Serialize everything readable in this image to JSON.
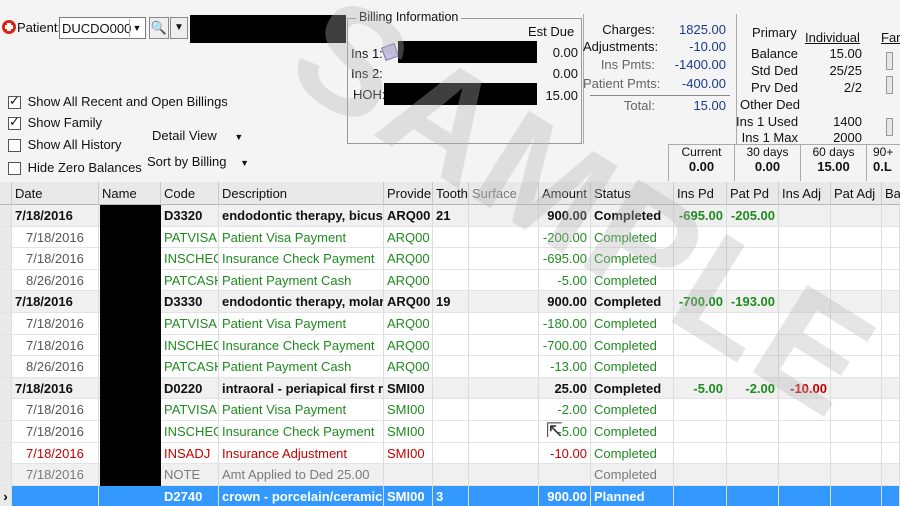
{
  "patient": {
    "label": "Patient:",
    "code": "DUCDO000"
  },
  "checkboxes": [
    {
      "label": "Show All Recent and Open Billings",
      "checked": true
    },
    {
      "label": "Show Family",
      "checked": true
    },
    {
      "label": "Show All History",
      "checked": false
    },
    {
      "label": "Hide Zero Balances",
      "checked": false
    }
  ],
  "dropdowns": {
    "detail": "Detail View",
    "sort": "Sort by Billing"
  },
  "billing": {
    "title": "Billing Information",
    "est_due_label": "Est Due",
    "rows": [
      {
        "label": "Ins 1:",
        "value": "0.00"
      },
      {
        "label": "Ins 2:",
        "value": "0.00"
      },
      {
        "label": "HOH:",
        "value": "15.00"
      }
    ]
  },
  "totals": {
    "rows": [
      {
        "label": "Charges:",
        "value": "1825.00"
      },
      {
        "label": "Adjustments:",
        "value": "-10.00"
      },
      {
        "label": "Ins Pmts:",
        "value": "-1400.00"
      },
      {
        "label": "Patient Pmts:",
        "value": "-400.00"
      },
      {
        "label": "Total:",
        "value": "15.00"
      }
    ]
  },
  "insurance": {
    "primary": "Primary",
    "individual": "Individual",
    "family_partial": "Far",
    "rows": [
      {
        "label": "Balance",
        "value": "15.00"
      },
      {
        "label": "Std Ded",
        "value": "25/25"
      },
      {
        "label": "Prv Ded",
        "value": "2/2"
      },
      {
        "label": "Other Ded",
        "value": ""
      },
      {
        "label": "Ins 1 Used",
        "value": "1400"
      },
      {
        "label": "Ins 1 Max",
        "value": "2000"
      }
    ]
  },
  "aging": [
    {
      "label": "Current",
      "value": "0.00"
    },
    {
      "label": "30 days",
      "value": "0.00"
    },
    {
      "label": "60 days",
      "value": "15.00"
    },
    {
      "label": "90+",
      "value": "0.L"
    }
  ],
  "columns": [
    "Date",
    "Name",
    "Code",
    "Description",
    "Provider",
    "Tooth",
    "Surface",
    "Amount",
    "Status",
    "Ins Pd",
    "Pat Pd",
    "Ins Adj",
    "Pat Adj",
    "Ba"
  ],
  "rows": [
    {
      "kind": "proc",
      "date": "7/18/2016",
      "code": "D3320",
      "desc": "endodontic therapy, bicus",
      "provider": "ARQ00",
      "tooth": "21",
      "amount": "900.00",
      "status": "Completed",
      "ins_pd": "-695.00",
      "pat_pd": "-205.00",
      "ins_adj": ""
    },
    {
      "kind": "pay",
      "date": "7/18/2016",
      "code": "PATVISA",
      "desc": "Patient Visa Payment",
      "provider": "ARQ00",
      "tooth": "",
      "amount": "-200.00",
      "status": "Completed",
      "ins_pd": "",
      "pat_pd": "",
      "ins_adj": ""
    },
    {
      "kind": "pay",
      "date": "7/18/2016",
      "code": "INSCHECI",
      "desc": "Insurance Check Payment",
      "provider": "ARQ00",
      "tooth": "",
      "amount": "-695.00",
      "status": "Completed",
      "ins_pd": "",
      "pat_pd": "",
      "ins_adj": ""
    },
    {
      "kind": "pay",
      "date": "8/26/2016",
      "code": "PATCASH",
      "desc": "Patient Payment Cash",
      "provider": "ARQ00",
      "tooth": "",
      "amount": "-5.00",
      "status": "Completed",
      "ins_pd": "",
      "pat_pd": "",
      "ins_adj": ""
    },
    {
      "kind": "proc",
      "date": "7/18/2016",
      "code": "D3330",
      "desc": "endodontic therapy, molar",
      "provider": "ARQ00",
      "tooth": "19",
      "amount": "900.00",
      "status": "Completed",
      "ins_pd": "-700.00",
      "pat_pd": "-193.00",
      "ins_adj": ""
    },
    {
      "kind": "pay",
      "date": "7/18/2016",
      "code": "PATVISA",
      "desc": "Patient Visa Payment",
      "provider": "ARQ00",
      "tooth": "",
      "amount": "-180.00",
      "status": "Completed",
      "ins_pd": "",
      "pat_pd": "",
      "ins_adj": ""
    },
    {
      "kind": "pay",
      "date": "7/18/2016",
      "code": "INSCHECI",
      "desc": "Insurance Check Payment",
      "provider": "ARQ00",
      "tooth": "",
      "amount": "-700.00",
      "status": "Completed",
      "ins_pd": "",
      "pat_pd": "",
      "ins_adj": ""
    },
    {
      "kind": "pay",
      "date": "8/26/2016",
      "code": "PATCASH",
      "desc": "Patient Payment Cash",
      "provider": "ARQ00",
      "tooth": "",
      "amount": "-13.00",
      "status": "Completed",
      "ins_pd": "",
      "pat_pd": "",
      "ins_adj": ""
    },
    {
      "kind": "proc",
      "date": "7/18/2016",
      "code": "D0220",
      "desc": "intraoral - periapical first r",
      "provider": "SMI00",
      "tooth": "",
      "amount": "25.00",
      "status": "Completed",
      "ins_pd": "-5.00",
      "pat_pd": "-2.00",
      "ins_adj": "-10.00"
    },
    {
      "kind": "pay",
      "date": "7/18/2016",
      "code": "PATVISA",
      "desc": "Patient Visa Payment",
      "provider": "SMI00",
      "tooth": "",
      "amount": "-2.00",
      "status": "Completed",
      "ins_pd": "",
      "pat_pd": "",
      "ins_adj": ""
    },
    {
      "kind": "pay",
      "date": "7/18/2016",
      "code": "INSCHECI",
      "desc": "Insurance Check Payment",
      "provider": "SMI00",
      "tooth": "",
      "amount": "-5.00",
      "status": "Completed",
      "ins_pd": "",
      "pat_pd": "",
      "ins_adj": ""
    },
    {
      "kind": "adj",
      "date": "7/18/2016",
      "code": "INSADJ",
      "desc": "Insurance Adjustment",
      "provider": "SMI00",
      "tooth": "",
      "amount": "-10.00",
      "status": "Completed",
      "ins_pd": "",
      "pat_pd": "",
      "ins_adj": ""
    },
    {
      "kind": "note",
      "date": "7/18/2016",
      "code": "NOTE",
      "desc": "Amt Applied to Ded 25.00",
      "provider": "",
      "tooth": "",
      "amount": "",
      "status": "Completed",
      "ins_pd": "",
      "pat_pd": "",
      "ins_adj": ""
    },
    {
      "kind": "sel",
      "date": "",
      "code": "D2740",
      "desc": "crown - porcelain/ceramic",
      "provider": "SMI00",
      "tooth": "3",
      "amount": "900.00",
      "status": "Planned",
      "ins_pd": "",
      "pat_pd": "",
      "ins_adj": ""
    }
  ],
  "watermark": "SAMPLE"
}
